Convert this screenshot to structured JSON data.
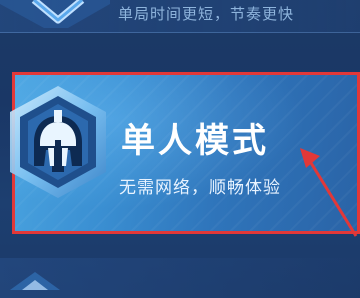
{
  "prev_mode": {
    "subtitle": "单局时间更短，节奏更快",
    "icon": "chevron-emblem-icon"
  },
  "selected_mode": {
    "title": "单人模式",
    "subtitle": "无需网络，顺畅体验",
    "icon": "spartan-helmet-icon"
  },
  "next_mode": {
    "icon": "mode-emblem-icon"
  },
  "colors": {
    "highlight": "#e23838",
    "card": "#3a8fd2",
    "background": "#1c3a66"
  }
}
